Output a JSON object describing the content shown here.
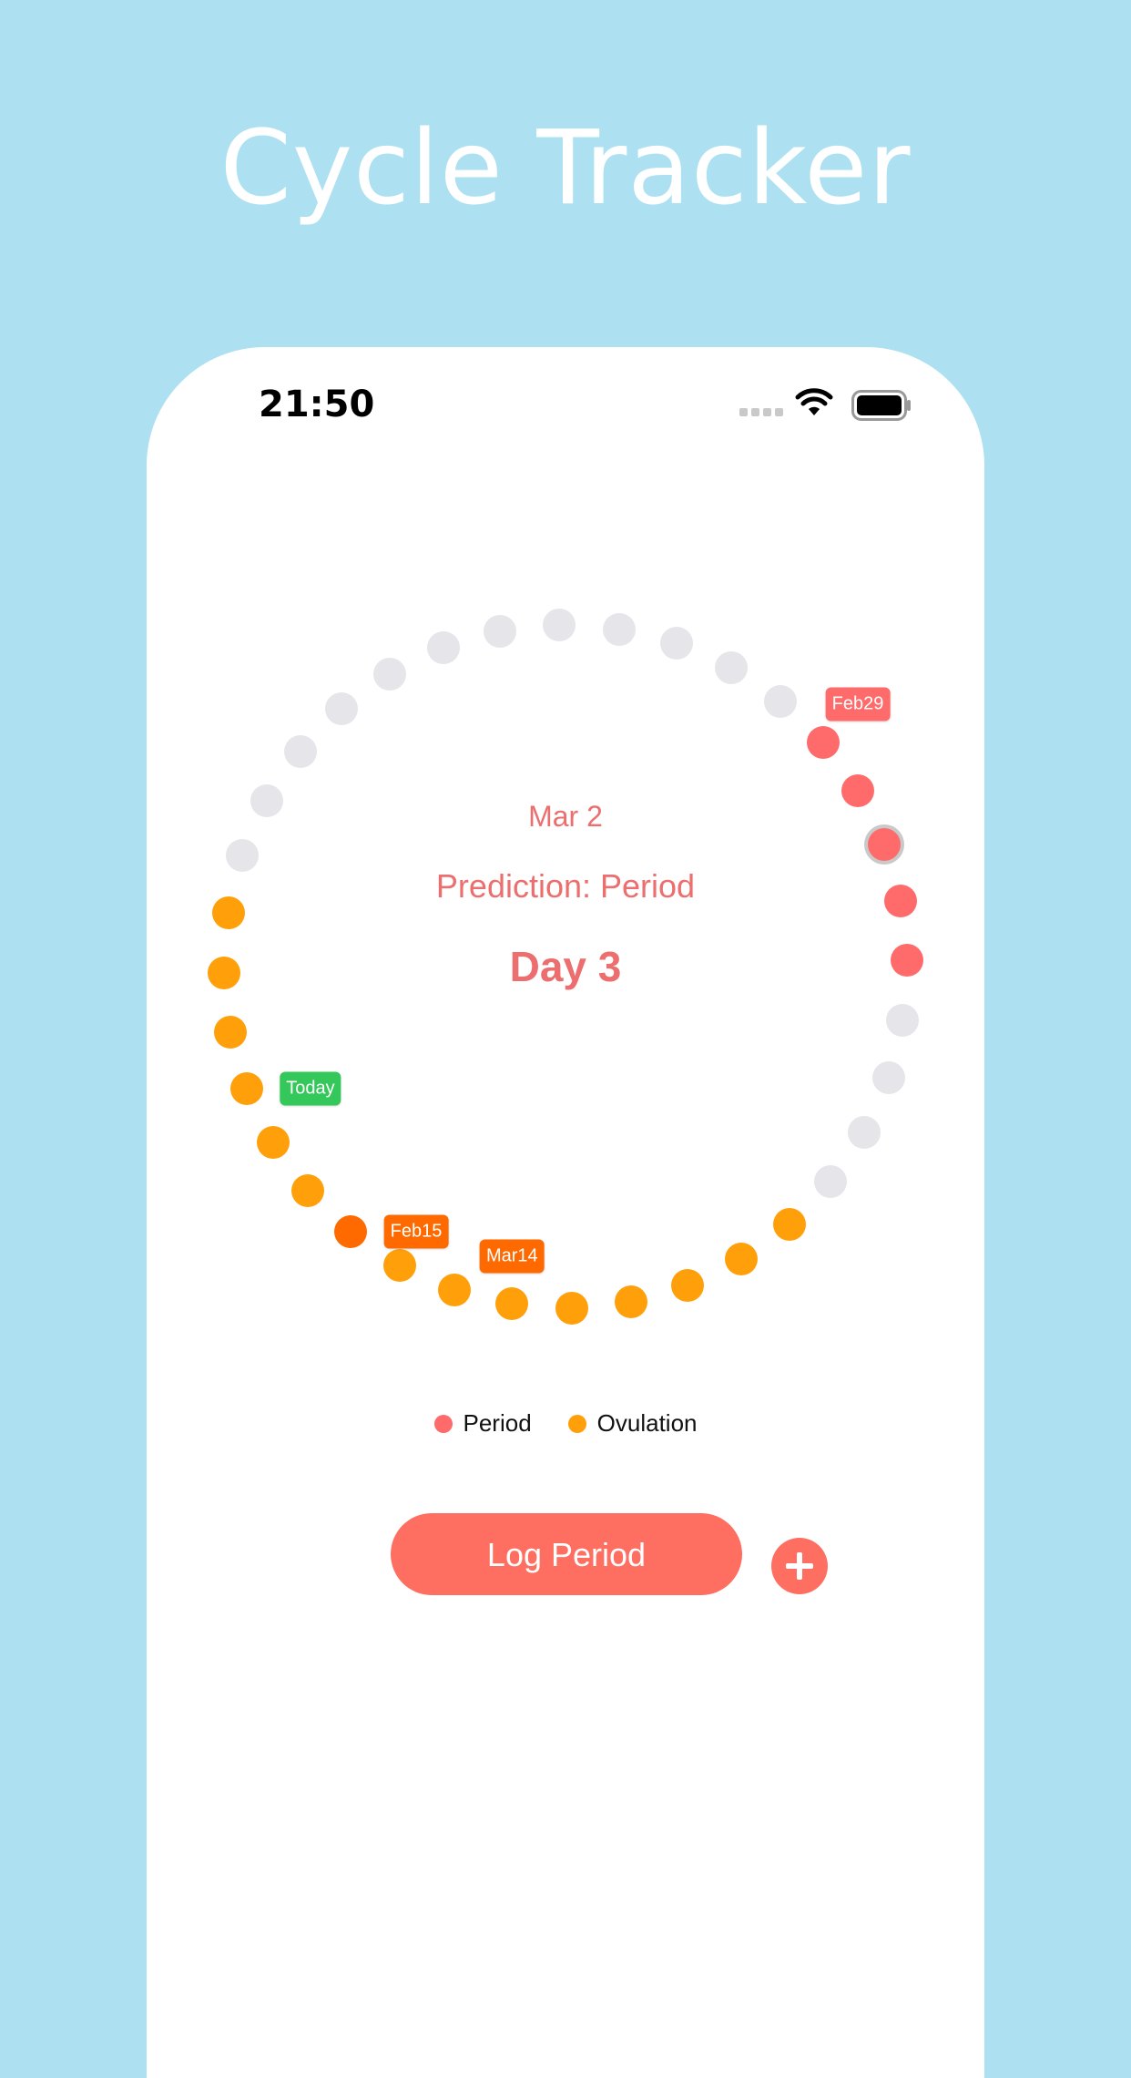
{
  "promo": {
    "title": "Cycle Tracker"
  },
  "status_bar": {
    "time": "21:50"
  },
  "center": {
    "date": "Mar 2",
    "prediction": "Prediction: Period",
    "day": "Day 3"
  },
  "legend": {
    "period_label": "Period",
    "ovulation_label": "Ovulation"
  },
  "actions": {
    "log_period_label": "Log Period"
  },
  "colors": {
    "period": "#FF6B6B",
    "ovulation": "#FF9F0A",
    "ovulation_peak": "#FF6A00",
    "inactive": "#E5E5EA",
    "today_tag": "#34C759",
    "accent": "#FF6F61",
    "background": "#ADE1F2"
  },
  "cycle": {
    "total_days": 36,
    "today_index": 20,
    "selected_index": 2,
    "dots": [
      "period",
      "period",
      "period",
      "period",
      "period",
      "inactive",
      "inactive",
      "inactive",
      "inactive",
      "ovulation",
      "ovulation",
      "ovulation",
      "ovulation",
      "ovulation",
      "ovulation",
      "ovulation",
      "ovulation",
      "ovulation_peak",
      "ovulation",
      "ovulation",
      "ovulation",
      "ovulation",
      "ovulation",
      "ovulation",
      "inactive",
      "inactive",
      "inactive",
      "inactive",
      "inactive",
      "inactive",
      "inactive",
      "inactive",
      "inactive",
      "inactive",
      "inactive",
      "inactive"
    ],
    "tags": [
      {
        "text": "Feb29",
        "color": "period"
      },
      {
        "text": "Mar14",
        "color": "ovulation_peak"
      },
      {
        "text": "Feb15",
        "color": "ovulation_peak"
      },
      {
        "text": "Today",
        "color": "today_tag"
      }
    ]
  }
}
